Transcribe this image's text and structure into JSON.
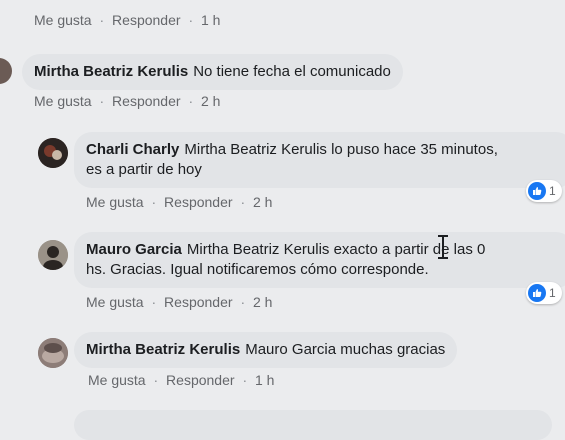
{
  "labels": {
    "like": "Me gusta",
    "reply": "Responder",
    "sep": "·"
  },
  "comments": [
    {
      "time": "1 h"
    },
    {
      "author": "Mirtha Beatriz Kerulis",
      "text": "No tiene fecha el comunicado",
      "time": "2 h"
    },
    {
      "author": "Charli Charly",
      "text_line1": "Mirtha Beatriz Kerulis lo puso hace 35 minutos,",
      "text_line2": "es a partir de hoy",
      "time": "2 h",
      "reactions": "1"
    },
    {
      "author": "Mauro Garcia",
      "text_line1": "Mirtha Beatriz Kerulis exacto a partir de las 0",
      "text_line2": "hs. Gracias. Igual notificaremos cómo corresponde.",
      "time": "2 h",
      "reactions": "1"
    },
    {
      "author": "Mirtha Beatriz Kerulis",
      "text": "Mauro Garcia muchas gracias",
      "time": "1 h"
    }
  ],
  "colors": {
    "like_blue": "#1877f2",
    "bubble": "#e2e4e7",
    "background": "#ebecee"
  },
  "icons": {
    "reaction": "like-thumb-icon",
    "cursor": "text-cursor-icon"
  }
}
